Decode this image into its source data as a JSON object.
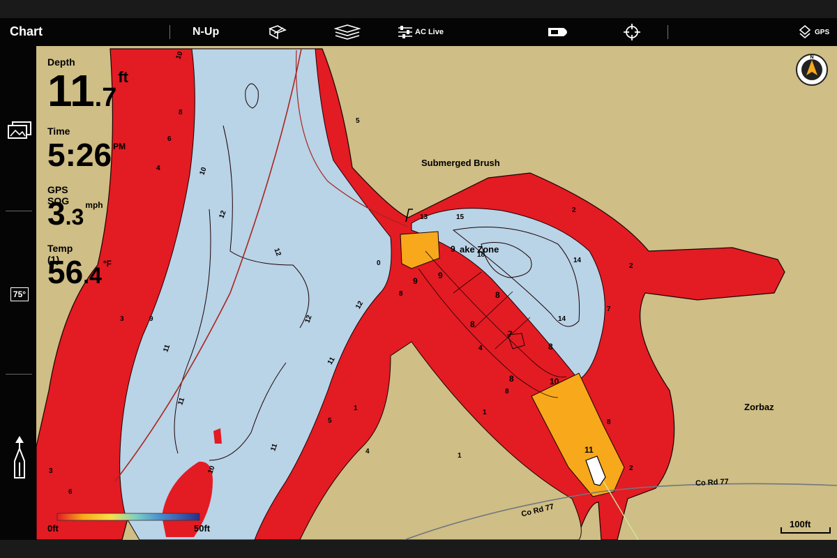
{
  "toolbar": {
    "title": "Chart",
    "orientation": "N-Up",
    "ac_live": "AC Live",
    "gps": "GPS",
    "icons": [
      "chart-settings-icon",
      "layers-icon",
      "ac-live-sliders-icon",
      "boat-view-icon",
      "crosshair-icon",
      "gps-status-icon"
    ]
  },
  "sidebar": {
    "icons": [
      "views-icon",
      "temperature-icon",
      "boat-position-icon"
    ],
    "temp_badge": "75°"
  },
  "readouts": {
    "depth": {
      "label": "Depth",
      "int": "11",
      "dec": ".7",
      "unit": "ft"
    },
    "time": {
      "label": "Time",
      "value": "5:26",
      "unit": "PM"
    },
    "sog": {
      "label": "GPS SOG",
      "int": "3",
      "dec": ".3",
      "unit": "mph"
    },
    "temp": {
      "label": "Temp (1)",
      "int": "56",
      "dec": ".4",
      "unit": "°F"
    }
  },
  "map_labels": {
    "submerged_brush": "Submerged Brush",
    "wake_zone": "ake Zone",
    "zorbaz": "Zorbaz",
    "road_a": "Co Rd 77",
    "road_b": "Co Rd 77"
  },
  "depth_labels": [
    "10",
    "8",
    "6",
    "4",
    "10",
    "12",
    "12",
    "12",
    "11",
    "11",
    "11",
    "10",
    "5",
    "13",
    "15",
    "18",
    "14",
    "14",
    "2",
    "2",
    "7",
    "8",
    "2",
    "0",
    "8",
    "12",
    "11",
    "1",
    "5",
    "3",
    "9",
    "4",
    "6",
    "3",
    "1",
    "4",
    "8",
    "9",
    "9",
    "9",
    "8",
    "8",
    "7",
    "8",
    "8",
    "10",
    "11",
    "1"
  ],
  "legend": {
    "min_label": "0ft",
    "max_label": "50ft"
  },
  "scale": {
    "label": "100ft"
  },
  "colors": {
    "land": "#cfbe85",
    "shallow": "#e31b23",
    "orange": "#f7a81b",
    "water": "#b9d3e7",
    "toolbar": "#050505"
  }
}
